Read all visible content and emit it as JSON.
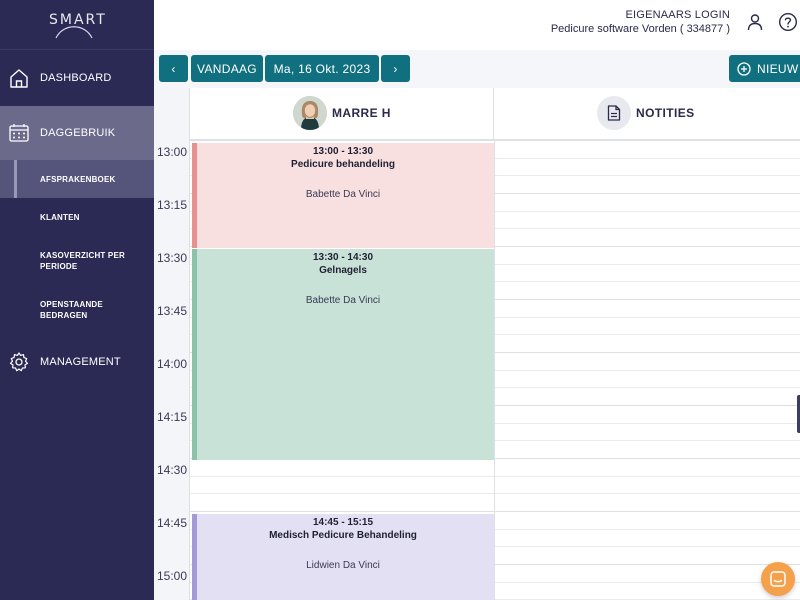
{
  "brand": {
    "logo_text": "SMART"
  },
  "sidebar": {
    "items": [
      {
        "label": "DASHBOARD",
        "icon": "home-icon"
      },
      {
        "label": "DAGGEBRUIK",
        "icon": "calendar-icon"
      },
      {
        "label": "MANAGEMENT",
        "icon": "gear-icon"
      }
    ],
    "subitems": [
      {
        "label": "AFSPRAKENBOEK"
      },
      {
        "label": "KLANTEN"
      },
      {
        "label_line1": "KASOVERZICHT PER",
        "label_line2": "PERIODE"
      },
      {
        "label_line1": "OPENSTAANDE",
        "label_line2": "BEDRAGEN"
      }
    ]
  },
  "header": {
    "owner_login": "EIGENAARS LOGIN",
    "company": "Pedicure software Vorden ( 334877 )"
  },
  "toolbar": {
    "prev": "‹",
    "today": "VANDAAG",
    "date": "Ma, 16 Okt. 2023",
    "next": "›",
    "new": "NIEUW"
  },
  "calendar": {
    "staff_name": "MARRE H",
    "notes_label": "NOTITIES",
    "times": [
      "13:00",
      "13:15",
      "13:30",
      "13:45",
      "14:00",
      "14:15",
      "14:30",
      "14:45",
      "15:00"
    ],
    "appointments": [
      {
        "time": "13:00 - 13:30",
        "title": "Pedicure behandeling",
        "client": "Babette Da Vinci",
        "bg": "#f7e0df",
        "stripe": "#e8908d"
      },
      {
        "time": "13:30 - 14:30",
        "title": "Gelnagels",
        "client": "Babette Da Vinci",
        "bg": "#c9e2d7",
        "stripe": "#8bc2a8"
      },
      {
        "time": "14:45 - 15:15",
        "title": "Medisch Pedicure Behandeling",
        "client": "Lidwien Da Vinci",
        "bg": "#e4e0f3",
        "stripe": "#a59ad8"
      }
    ]
  },
  "colors": {
    "sidebar": "#2b2a55",
    "accent": "#11707f",
    "chat": "#f5a04a"
  }
}
